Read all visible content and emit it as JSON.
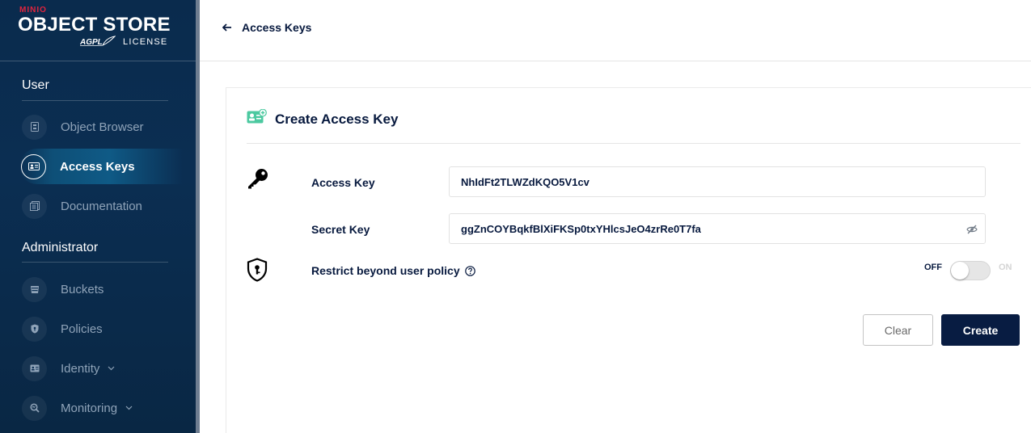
{
  "brand": {
    "minio": "MINIO",
    "title": "OBJECT STORE",
    "agpl": "AGPL",
    "license": "LICENSE"
  },
  "sidebar": {
    "user_section": "User",
    "admin_section": "Administrator",
    "items": [
      {
        "label": "Object Browser",
        "icon": "object-browser-icon",
        "active": false
      },
      {
        "label": "Access Keys",
        "icon": "access-keys-icon",
        "active": true
      },
      {
        "label": "Documentation",
        "icon": "documentation-icon",
        "active": false
      },
      {
        "label": "Buckets",
        "icon": "buckets-icon",
        "active": false
      },
      {
        "label": "Policies",
        "icon": "policies-icon",
        "active": false
      },
      {
        "label": "Identity",
        "icon": "identity-icon",
        "active": false,
        "expandable": true
      },
      {
        "label": "Monitoring",
        "icon": "monitoring-icon",
        "active": false,
        "expandable": true
      }
    ]
  },
  "header": {
    "back_label": "Access Keys"
  },
  "form": {
    "title": "Create Access Key",
    "access_key_label": "Access Key",
    "access_key_value": "NhIdFt2TLWZdKQO5V1cv",
    "secret_key_label": "Secret Key",
    "secret_key_value": "ggZnCOYBqkfBlXiFKSp0txYHlcsJeO4zrRe0T7fa",
    "restrict_label": "Restrict beyond user policy",
    "toggle_off": "OFF",
    "toggle_on": "ON",
    "toggle_state": "off",
    "clear_label": "Clear",
    "create_label": "Create"
  },
  "colors": {
    "sidebar_bg": "#0b2e52",
    "primary": "#081c42",
    "brand_red": "#e0243e",
    "accent_green": "#4cc9a0"
  }
}
